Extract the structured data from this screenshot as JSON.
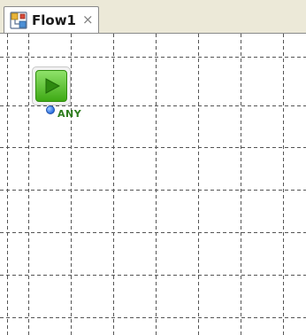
{
  "tab": {
    "title": "Flow1",
    "close_glyph": "×",
    "icon": "flow-diagram-icon"
  },
  "canvas": {
    "grid": "dashed",
    "start_node": {
      "icon": "play-icon",
      "port_label": "ANY",
      "accent": "#4cbb1f",
      "port_color": "#2b6fe0"
    }
  }
}
